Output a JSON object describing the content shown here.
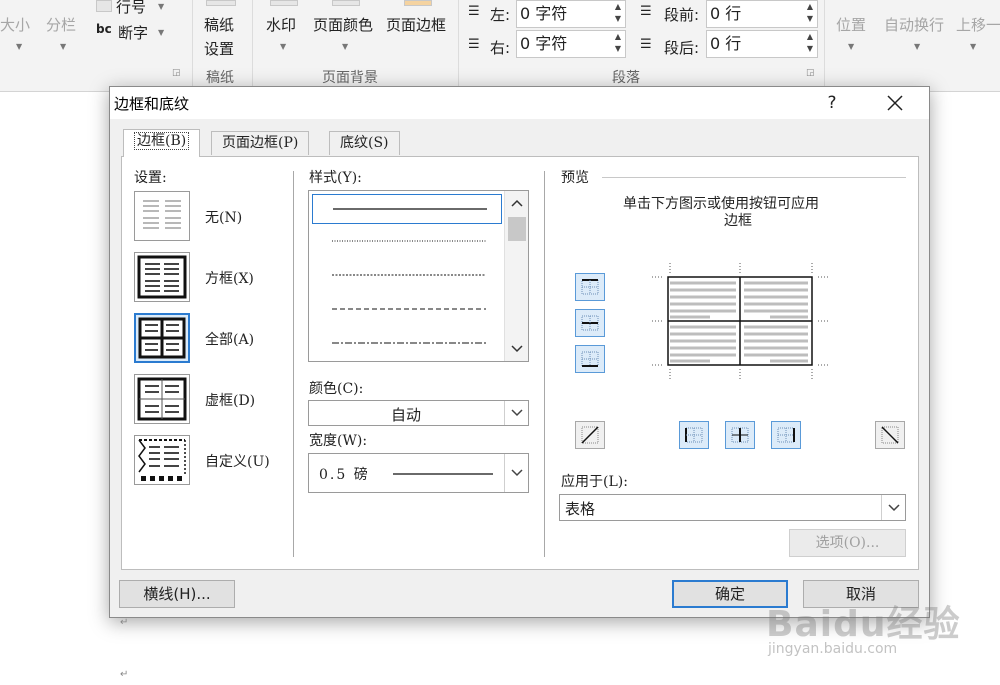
{
  "ribbon": {
    "size_label": "大小",
    "columns_label": "分栏",
    "line_numbers_label": "行号",
    "hyphenation_label": "断字",
    "draft_label_line1": "稿纸",
    "draft_label_line2": "设置",
    "draft_group": "稿纸",
    "watermark_label": "水印",
    "page_color_label": "页面颜色",
    "page_borders_label": "页面边框",
    "page_background_group": "页面背景",
    "indent_left_label": "左:",
    "indent_left_value": "0 字符",
    "indent_right_label": "右:",
    "indent_right_value": "0 字符",
    "space_before_label": "段前:",
    "space_before_value": "0 行",
    "space_after_label": "段后:",
    "space_after_value": "0 行",
    "paragraph_group": "段落",
    "position_label": "位置",
    "wrap_text_label": "自动换行",
    "bring_forward_label": "上移一"
  },
  "dialog": {
    "title": "边框和底纹",
    "help": "?",
    "tabs": [
      {
        "label": "边框(B)",
        "active": true
      },
      {
        "label": "页面边框(P)",
        "active": false
      },
      {
        "label": "底纹(S)",
        "active": false
      }
    ],
    "settings_label": "设置:",
    "settings": [
      {
        "label": "无(N)",
        "icon": "none-border-icon"
      },
      {
        "label": "方框(X)",
        "icon": "box-border-icon"
      },
      {
        "label": "全部(A)",
        "icon": "all-borders-icon",
        "selected": true
      },
      {
        "label": "虚框(D)",
        "icon": "grid-border-icon"
      },
      {
        "label": "自定义(U)",
        "icon": "custom-border-icon"
      }
    ],
    "style_label": "样式(Y):",
    "color_label": "颜色(C):",
    "color_value": "自动",
    "width_label": "宽度(W):",
    "width_value": "0.5 磅",
    "preview_label": "预览",
    "preview_hint_line1": "单击下方图示或使用按钮可应用",
    "preview_hint_line2": "边框",
    "apply_to_label": "应用于(L):",
    "apply_to_value": "表格",
    "options_button": "选项(O)...",
    "horizontal_line_button": "横线(H)...",
    "ok_button": "确定",
    "cancel_button": "取消"
  },
  "watermark": {
    "text": "Baidu经验",
    "url": "jingyan.baidu.com"
  },
  "colors": {
    "accent": "#2b7bd0",
    "selected_fill": "#dcebf9",
    "dialog_bg": "#f0f0f0"
  }
}
